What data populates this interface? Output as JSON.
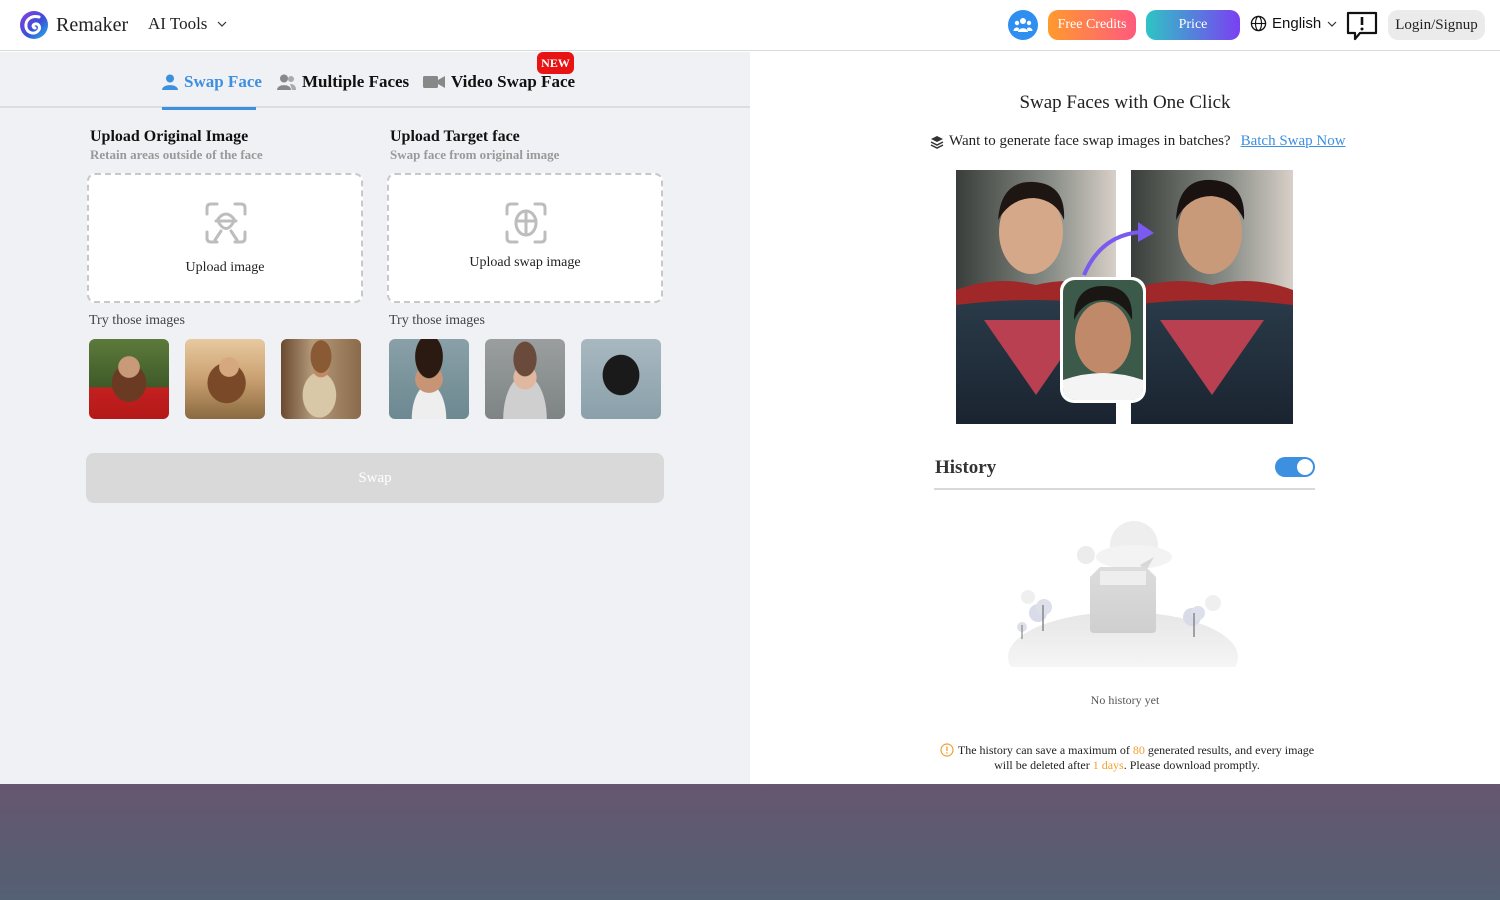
{
  "header": {
    "brand": "Remaker",
    "ai_tools_label": "AI Tools",
    "community_icon": "people-group-icon",
    "free_credits_label": "Free Credits",
    "price_label": "Price",
    "language_label": "English",
    "feedback_icon": "feedback-exclamation-icon",
    "login_label": "Login/Signup"
  },
  "tabs": [
    {
      "label": "Swap Face",
      "icon": "person-icon",
      "active": true
    },
    {
      "label": "Multiple Faces",
      "icon": "people-icon",
      "active": false
    },
    {
      "label": "Video Swap Face",
      "icon": "video-camera-icon",
      "active": false,
      "badge": "NEW"
    }
  ],
  "upload": {
    "original": {
      "title": "Upload Original Image",
      "subtitle": "Retain areas outside of the face",
      "button_label": "Upload image",
      "try_label": "Try those images",
      "samples": [
        "woman in red top in forest",
        "woman with long hair at sunset",
        "cowboy leaning on post"
      ]
    },
    "target": {
      "title": "Upload Target face",
      "subtitle": "Swap face from original image",
      "button_label": "Upload swap image",
      "try_label": "Try those images",
      "samples": [
        "young man with curly hair",
        "young woman with tied hair",
        "asian woman with long black hair"
      ]
    },
    "swap_label": "Swap"
  },
  "right": {
    "title": "Swap Faces with One Click",
    "batch_prompt": "Want to generate face swap images in batches?",
    "batch_link": "Batch Swap Now",
    "history": {
      "title": "History",
      "enabled": true,
      "empty_text": "No history yet",
      "notice_prefix": "The history can save a maximum of ",
      "max_results": "80",
      "notice_mid": " generated results, and every image will be deleted after ",
      "retention": "1 days",
      "notice_suffix": ". Please download promptly."
    }
  },
  "colors": {
    "accent": "#3d8fe0",
    "new_badge": "#e81414",
    "highlight": "#f0a030"
  }
}
